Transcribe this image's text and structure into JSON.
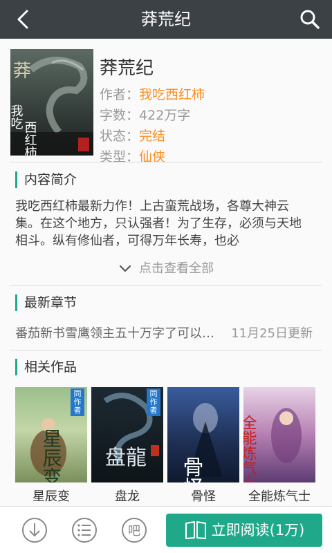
{
  "header": {
    "title": "莽荒纪",
    "back_icon": "chevron-left-icon",
    "search_icon": "search-icon"
  },
  "book": {
    "title": "莽荒纪",
    "author_label": "作者：",
    "author": "我吃西红柿",
    "words_label": "字数：",
    "words": "422万字",
    "status_label": "状态：",
    "status": "完结",
    "genre_label": "类型：",
    "genre": "仙侠",
    "cover_text": "莽荒纪 我吃西红柿",
    "accent_color": "#ff8c1a"
  },
  "intro": {
    "heading": "内容简介",
    "text": "我吃西红柿最新力作！上古蛮荒战场，各尊大神云集。在这个地方，只认强者！为了生存，必须与天地相斗。纵有修仙者，可得万年长寿，也必",
    "expand_label": "点击查看全部"
  },
  "latest": {
    "heading": "最新章节",
    "chapter_title": "番茄新书雪鹰领主五十万字了可以宰了",
    "updated": "11月25日更新"
  },
  "related": {
    "heading": "相关作品",
    "badge": "同作者",
    "items": [
      {
        "name": "星辰变",
        "cover_text": "星辰变"
      },
      {
        "name": "盘龙",
        "cover_text": "盘龍"
      },
      {
        "name": "骨怪",
        "cover_text": "骨怪"
      },
      {
        "name": "全能炼气士",
        "cover_text": "全能炼气士"
      }
    ]
  },
  "bottom": {
    "download_icon": "download-icon",
    "catalog_icon": "list-icon",
    "forum_label": "吧",
    "read_label": "立即阅读(1万)",
    "accent_color": "#1fa98a"
  }
}
